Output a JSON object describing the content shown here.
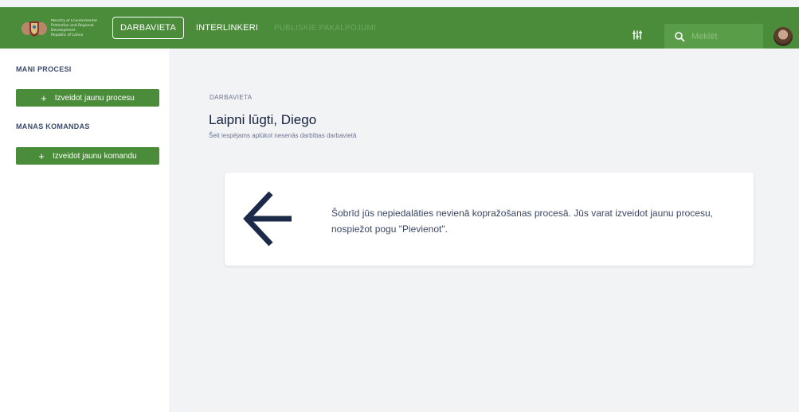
{
  "header": {
    "logo_lines": [
      "Ministry of Environmental",
      "Protection and Regional",
      "Development",
      "Republic of Latvia"
    ],
    "nav": {
      "workspace": "DARBAVIETA",
      "interlinkeri": "INTERLINKERI",
      "public_services": "PUBLISKIE PAKALPOJUMI"
    },
    "search": {
      "placeholder": "Meklēt",
      "value": ""
    },
    "colors": {
      "bar": "#4a8c3a",
      "search_bg": "#5a9d48"
    }
  },
  "sidebar": {
    "my_processes_heading": "MANI PROCESI",
    "create_process_label": "Izveidot jaunu procesu",
    "my_teams_heading": "MANAS KOMANDAS",
    "create_team_label": "Izveidot jaunu komandu"
  },
  "main": {
    "breadcrumb": "DARBAVIETA",
    "title": "Laipni lūgti, Diego",
    "subtitle": "Šeit iespējams aplūkot nesenās darbības darbavietā",
    "info_card": {
      "icon": "arrow-left-icon",
      "text": "Šobrīd jūs nepiedalāties nevienā kopražošanas procesā. Jūs varat izveidot jaunu procesu, nospiežot pogu \"Pievienot\"."
    }
  }
}
